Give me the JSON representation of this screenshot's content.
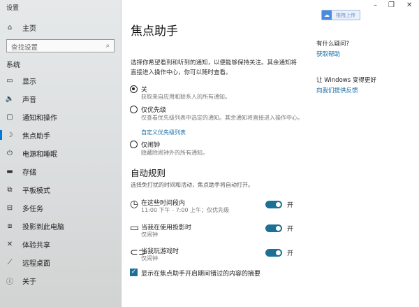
{
  "window": {
    "title": "设置",
    "minimize": "–",
    "maximize": "❐",
    "close": "✕"
  },
  "sidebar": {
    "home": "主页",
    "search_placeholder": "查找设置",
    "section": "系统",
    "items": [
      {
        "label": "显示",
        "icon": "▭"
      },
      {
        "label": "声音",
        "icon": "🔈"
      },
      {
        "label": "通知和操作",
        "icon": "▢"
      },
      {
        "label": "焦点助手",
        "icon": "☽"
      },
      {
        "label": "电源和睡眠",
        "icon": "⏻"
      },
      {
        "label": "存储",
        "icon": "▬"
      },
      {
        "label": "平板模式",
        "icon": "⧉"
      },
      {
        "label": "多任务",
        "icon": "⊟"
      },
      {
        "label": "投影到此电脑",
        "icon": "⧈"
      },
      {
        "label": "体验共享",
        "icon": "✕"
      },
      {
        "label": "远程桌面",
        "icon": "⟋"
      },
      {
        "label": "关于",
        "icon": "ⓘ"
      }
    ]
  },
  "main": {
    "title": "焦点助手",
    "description": "选择你希望看到和听到的通知，以便能够保持关注。其余通知将直接进入操作中心，你可以随时查看。",
    "options": [
      {
        "label": "关",
        "desc": "获取来自应用和联系人的所有通知。",
        "selected": true
      },
      {
        "label": "仅优先级",
        "desc": "仅查看优先级列表中选定的通知。其余通知将直接进入操作中心。",
        "link": "自定义优先级列表",
        "selected": false
      },
      {
        "label": "仅闹钟",
        "desc": "隐藏除闹钟外的所有通知。",
        "selected": false
      }
    ],
    "rules_heading": "自动规则",
    "rules_desc": "选择免打扰的时间和活动，焦点助手将自动打开。",
    "rules": [
      {
        "title": "在这些时间段内",
        "sub": "11:00 下午 - 7:00 上午；仅优先级",
        "state": "开",
        "on": true
      },
      {
        "title": "当我在使用投影时",
        "sub": "仅闹钟",
        "state": "开",
        "on": true
      },
      {
        "title": "当我玩游戏时",
        "sub": "仅闹钟",
        "state": "开",
        "on": true
      }
    ],
    "summary_checkbox": "显示在焦点助手开启期间错过的内容的摘要",
    "summary_checked": true
  },
  "right": {
    "upload": "拖拽上传",
    "question": "有什么疑问?",
    "help": "获取帮助",
    "improve": "让 Windows 变得更好",
    "feedback": "向我们提供反馈"
  },
  "colors": {
    "accent": "#1c6f95",
    "link": "#1a6fa8"
  }
}
